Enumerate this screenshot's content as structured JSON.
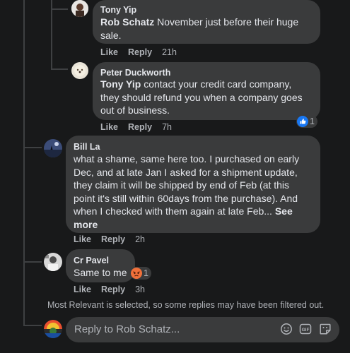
{
  "comments": [
    {
      "author": "Tony Yip",
      "mention": "Rob Schatz",
      "text_line1": " November just before their huge",
      "text_line2": "sale.",
      "like": "Like",
      "reply": "Reply",
      "time": "21h"
    },
    {
      "author": "Peter Duckworth",
      "mention": "Tony Yip",
      "text_line1": " contact your credit card company,",
      "text_line2": "they should refund you when a company goes",
      "text_line3": "out of business.",
      "like": "Like",
      "reply": "Reply",
      "time": "7h",
      "reaction_count": "1",
      "reaction_icon": "thumbs-up-icon"
    },
    {
      "author": "Bill La",
      "lines": [
        "what a shame, same here too. I purchased on early",
        "Dec, and at late Jan I asked for a shipment update,",
        "they claim it will be shipped by end of Feb (at this",
        "point it's still within 60days from the purchase). And",
        "when I checked with them again at late Feb... "
      ],
      "see_more_1": "See",
      "see_more_2": "more",
      "like": "Like",
      "reply": "Reply",
      "time": "2h"
    },
    {
      "author": "Cr Pavel",
      "text": "Same to me",
      "like": "Like",
      "reply": "Reply",
      "time": "3h",
      "reaction_count": "1",
      "reaction_icon": "angry-face-icon"
    }
  ],
  "filter_note": "Most Relevant is selected, so some replies may have been filtered out.",
  "reply_box": {
    "placeholder": "Reply to Rob Schatz...",
    "icons": [
      "emoji-icon",
      "gif-icon",
      "sticker-icon"
    ]
  },
  "colors": {
    "background": "#18191a",
    "bubble": "#3a3b3c",
    "secondary_text": "#b0b3b8",
    "like_blue": "#1877f2",
    "angry_orange": "#f0703a"
  }
}
